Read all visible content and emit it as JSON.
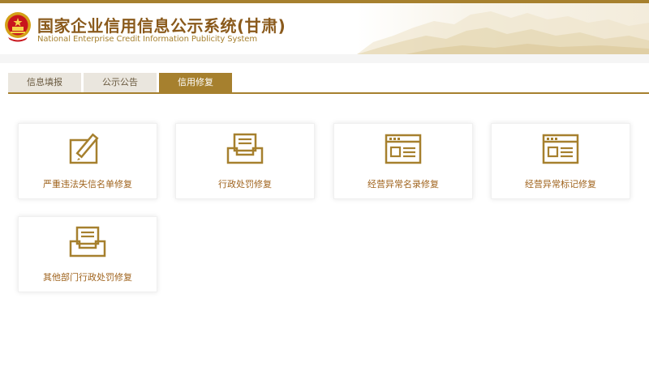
{
  "header": {
    "title_cn": "国家企业信用信息公示系统(甘肃)",
    "title_en": "National Enterprise Credit Information Publicity System"
  },
  "tabs": [
    {
      "label": "信息填报",
      "active": false
    },
    {
      "label": "公示公告",
      "active": false
    },
    {
      "label": "信用修复",
      "active": true
    }
  ],
  "cards": [
    {
      "label": "严重违法失信名单修复",
      "icon": "edit-document-icon"
    },
    {
      "label": "行政处罚修复",
      "icon": "inbox-tray-icon"
    },
    {
      "label": "经营异常名录修复",
      "icon": "browser-window-icon"
    },
    {
      "label": "经营异常标记修复",
      "icon": "browser-window-icon"
    },
    {
      "label": "其他部门行政处罚修复",
      "icon": "inbox-tray-icon"
    }
  ],
  "colors": {
    "accent": "#a6802e",
    "title": "#8a5a1c",
    "card_label": "#a0641e"
  }
}
